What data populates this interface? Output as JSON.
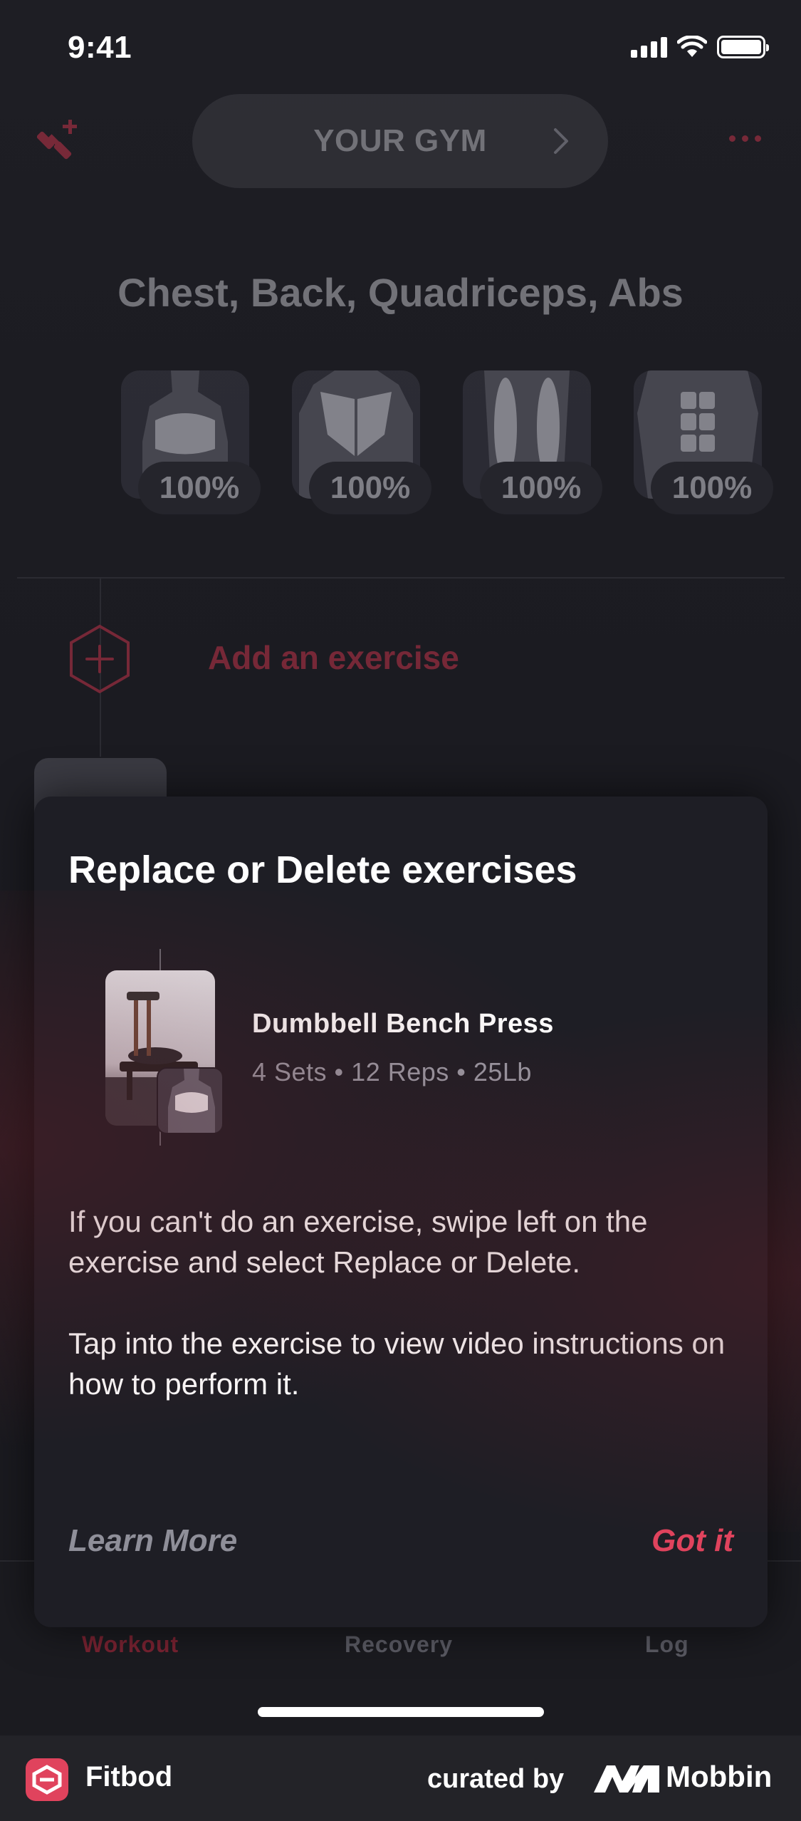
{
  "status_bar": {
    "time": "9:41"
  },
  "header": {
    "gym_label": "YOUR GYM"
  },
  "workout": {
    "muscle_groups_title": "Chest, Back, Quadriceps, Abs",
    "muscles": [
      {
        "name": "Chest",
        "percent": "100%"
      },
      {
        "name": "Back",
        "percent": "100%"
      },
      {
        "name": "Quadriceps",
        "percent": "100%"
      },
      {
        "name": "Abs",
        "percent": "100%"
      }
    ],
    "add_exercise_label": "Add an exercise"
  },
  "modal": {
    "title": "Replace or Delete exercises",
    "exercise": {
      "name": "Dumbbell Bench Press",
      "meta": "4 Sets • 12 Reps  • 25Lb"
    },
    "paragraphs": [
      "If you can't do an exercise, swipe left on the exercise and select Replace or Delete.",
      "Tap into the exercise to view video instructions on how to perform it."
    ],
    "learn_more_label": "Learn More",
    "got_it_label": "Got it"
  },
  "tabs": [
    {
      "label": "Workout",
      "active": true
    },
    {
      "label": "Recovery",
      "active": false
    },
    {
      "label": "Log",
      "active": false
    }
  ],
  "footer": {
    "app_name": "Fitbod",
    "curated_by": "curated by",
    "brand": "Mobbin"
  },
  "colors": {
    "accent": "#e0435d",
    "background": "#1e1e24"
  }
}
